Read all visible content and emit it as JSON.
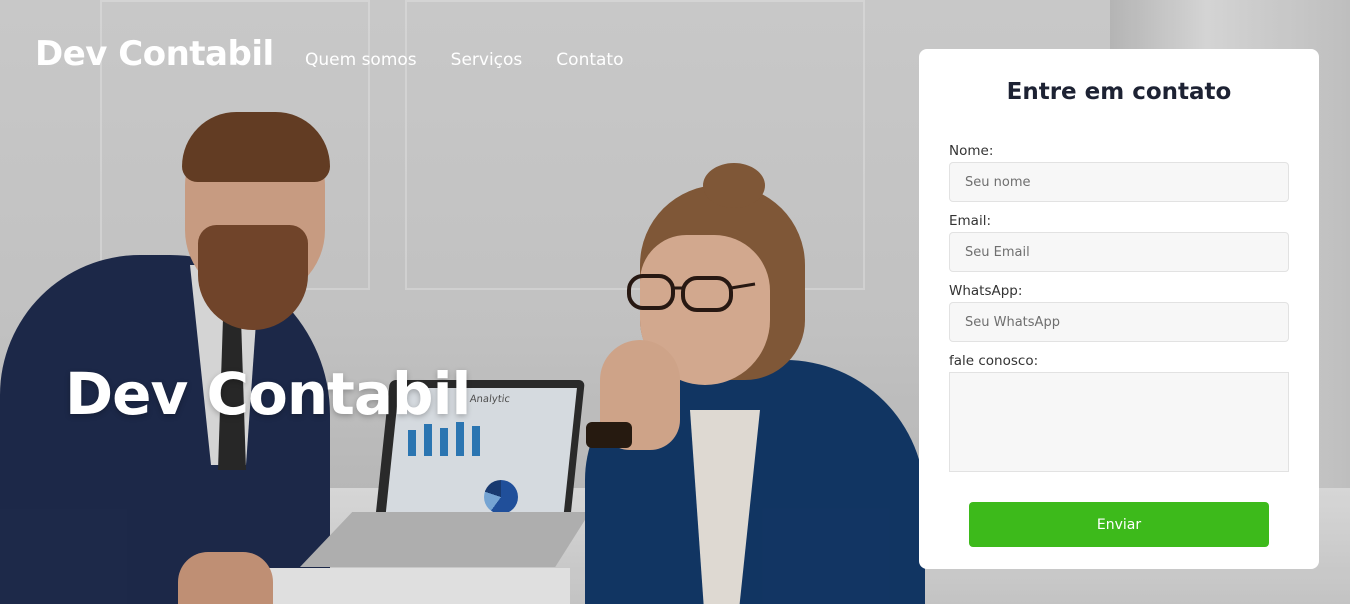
{
  "header": {
    "logo": "Dev Contabil",
    "nav": [
      {
        "label": "Quem somos"
      },
      {
        "label": "Serviços"
      },
      {
        "label": "Contato"
      }
    ]
  },
  "hero": {
    "title": "Dev Contabil",
    "laptop_screen_label": "Analytic"
  },
  "contact_form": {
    "title": "Entre em contato",
    "fields": {
      "name": {
        "label": "Nome:",
        "placeholder": "Seu nome",
        "value": ""
      },
      "email": {
        "label": "Email:",
        "placeholder": "Seu Email",
        "value": ""
      },
      "whatsapp": {
        "label": "WhatsApp:",
        "placeholder": "Seu WhatsApp",
        "value": ""
      },
      "message": {
        "label": "fale conosco:",
        "value": ""
      }
    },
    "submit_label": "Enviar"
  },
  "colors": {
    "submit_button": "#3dba1b",
    "card_title": "#1d2233",
    "woman_jacket": "#133a6b",
    "man_jacket": "#1f2c4f"
  }
}
